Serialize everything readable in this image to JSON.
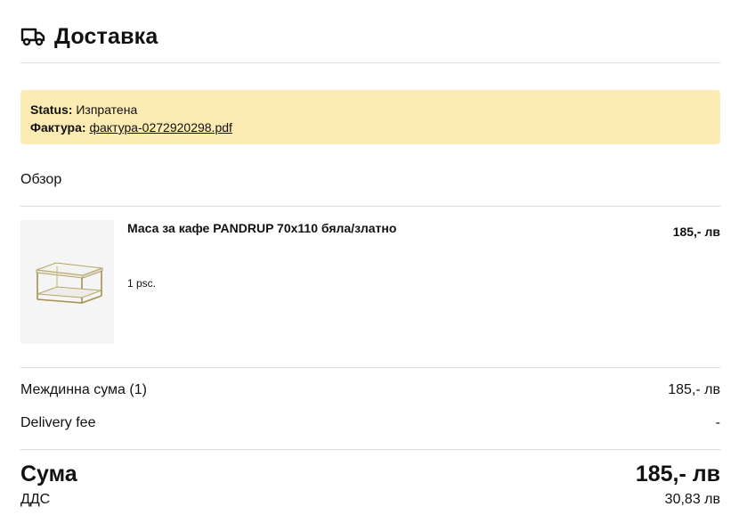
{
  "header": {
    "title": "Доставка",
    "icon": "truck-icon"
  },
  "status": {
    "status_label": "Status:",
    "status_value": "Изпратена",
    "invoice_label": "Фактура:",
    "invoice_link": "фактура-0272920298.pdf"
  },
  "overview": {
    "title": "Обзор"
  },
  "item": {
    "name": "Маса за кафе PANDRUP 70x110 бяла/златно",
    "price": "185,- лв",
    "quantity": "1 psc."
  },
  "summary": {
    "subtotal_label": "Междинна сума (1)",
    "subtotal_value": "185,- лв",
    "delivery_label": "Delivery fee",
    "delivery_value": "-",
    "total_label": "Сума",
    "total_value": "185,- лв",
    "vat_label": "ДДС",
    "vat_value": "30,83 лв"
  },
  "colors": {
    "status_bg": "#fcebb2",
    "divider": "#dcdcdc",
    "image_bg": "#f5f5f5"
  }
}
